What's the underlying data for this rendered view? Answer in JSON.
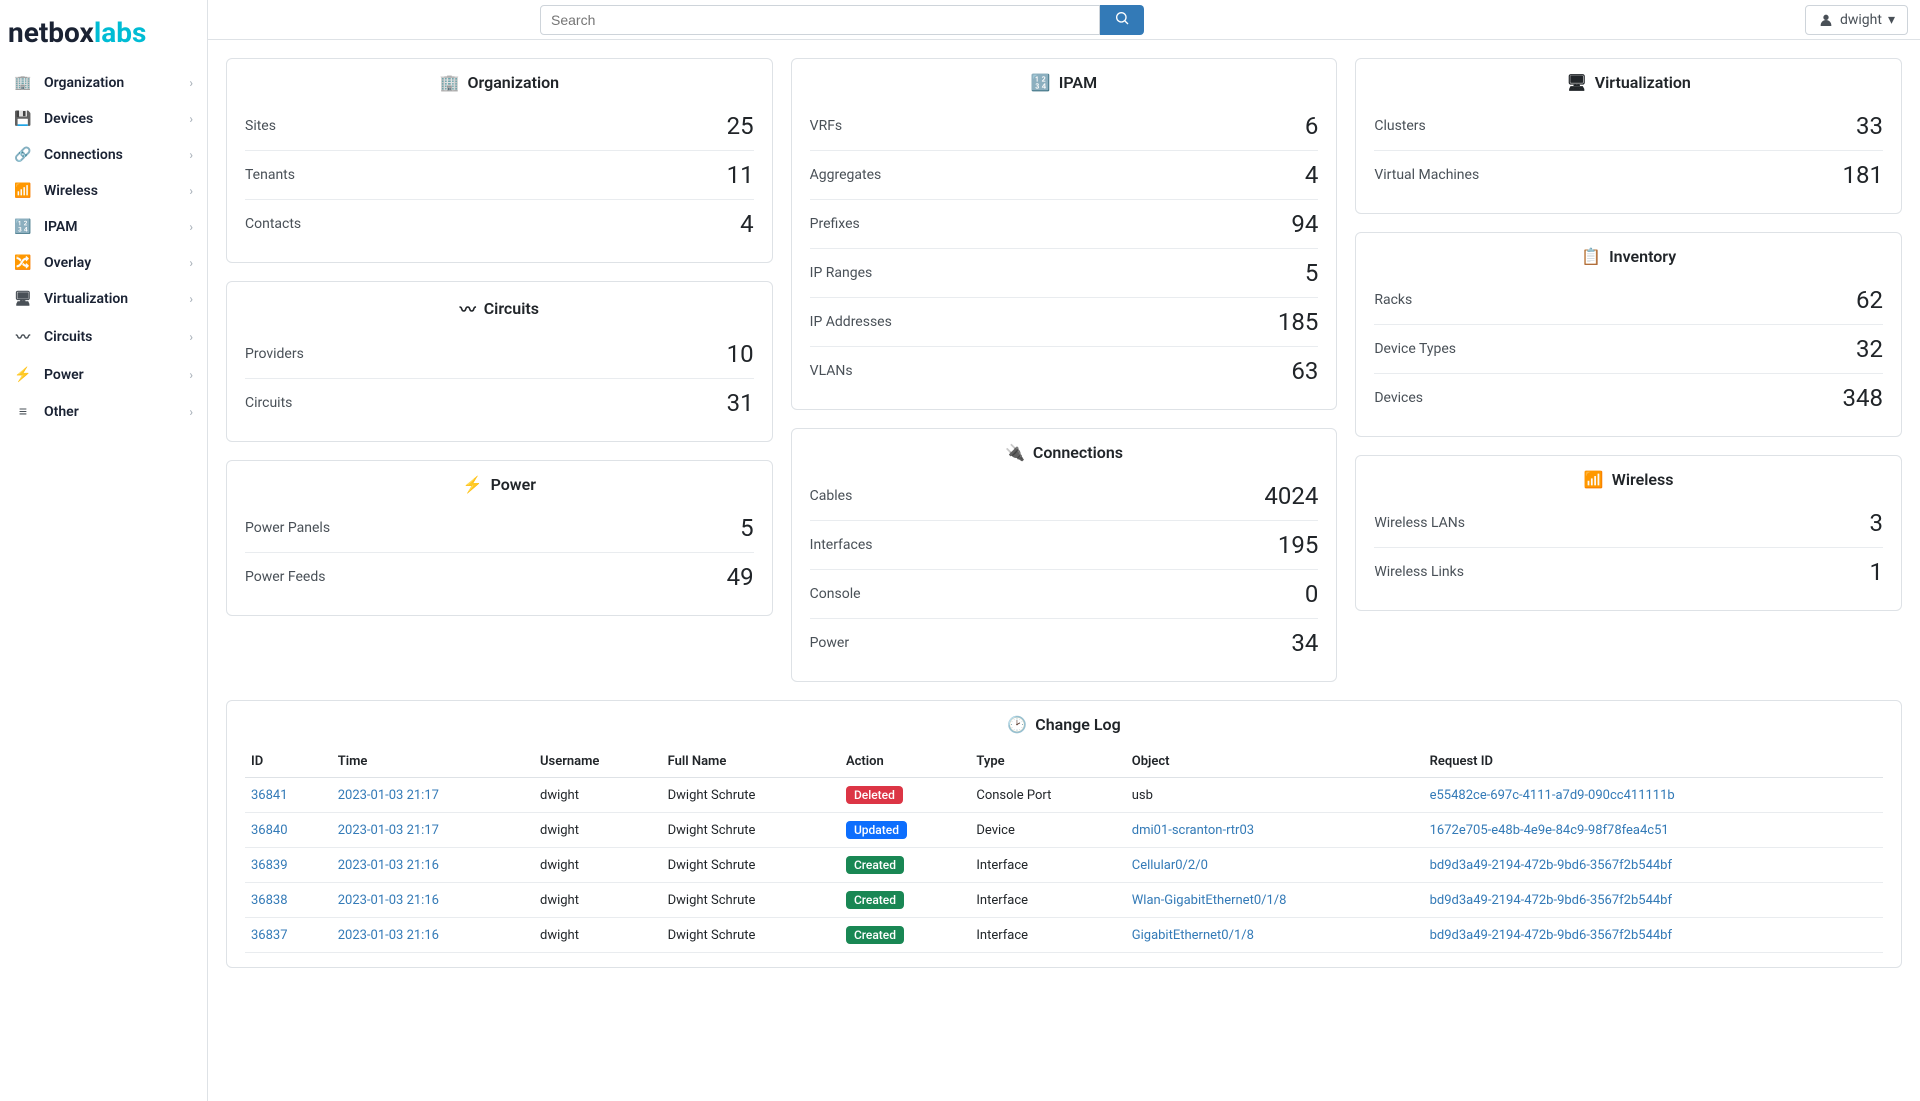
{
  "brand": {
    "part1": "netbox",
    "part2": "labs"
  },
  "search": {
    "placeholder": "Search"
  },
  "user": {
    "name": "dwight"
  },
  "nav": [
    {
      "label": "Organization"
    },
    {
      "label": "Devices"
    },
    {
      "label": "Connections"
    },
    {
      "label": "Wireless"
    },
    {
      "label": "IPAM"
    },
    {
      "label": "Overlay"
    },
    {
      "label": "Virtualization"
    },
    {
      "label": "Circuits"
    },
    {
      "label": "Power"
    },
    {
      "label": "Other"
    }
  ],
  "cards": {
    "organization": {
      "title": "Organization",
      "rows": [
        {
          "label": "Sites",
          "value": "25"
        },
        {
          "label": "Tenants",
          "value": "11"
        },
        {
          "label": "Contacts",
          "value": "4"
        }
      ]
    },
    "circuits": {
      "title": "Circuits",
      "rows": [
        {
          "label": "Providers",
          "value": "10"
        },
        {
          "label": "Circuits",
          "value": "31"
        }
      ]
    },
    "power": {
      "title": "Power",
      "rows": [
        {
          "label": "Power Panels",
          "value": "5"
        },
        {
          "label": "Power Feeds",
          "value": "49"
        }
      ]
    },
    "ipam": {
      "title": "IPAM",
      "rows": [
        {
          "label": "VRFs",
          "value": "6"
        },
        {
          "label": "Aggregates",
          "value": "4"
        },
        {
          "label": "Prefixes",
          "value": "94"
        },
        {
          "label": "IP Ranges",
          "value": "5"
        },
        {
          "label": "IP Addresses",
          "value": "185"
        },
        {
          "label": "VLANs",
          "value": "63"
        }
      ]
    },
    "connections": {
      "title": "Connections",
      "rows": [
        {
          "label": "Cables",
          "value": "4024"
        },
        {
          "label": "Interfaces",
          "value": "195"
        },
        {
          "label": "Console",
          "value": "0"
        },
        {
          "label": "Power",
          "value": "34"
        }
      ]
    },
    "virtualization": {
      "title": "Virtualization",
      "rows": [
        {
          "label": "Clusters",
          "value": "33"
        },
        {
          "label": "Virtual Machines",
          "value": "181"
        }
      ]
    },
    "inventory": {
      "title": "Inventory",
      "rows": [
        {
          "label": "Racks",
          "value": "62"
        },
        {
          "label": "Device Types",
          "value": "32"
        },
        {
          "label": "Devices",
          "value": "348"
        }
      ]
    },
    "wireless": {
      "title": "Wireless",
      "rows": [
        {
          "label": "Wireless LANs",
          "value": "3"
        },
        {
          "label": "Wireless Links",
          "value": "1"
        }
      ]
    }
  },
  "changelog": {
    "title": "Change Log",
    "headers": [
      "ID",
      "Time",
      "Username",
      "Full Name",
      "Action",
      "Type",
      "Object",
      "Request ID"
    ],
    "rows": [
      {
        "id": "36841",
        "time": "2023-01-03 21:17",
        "username": "dwight",
        "fullname": "Dwight Schrute",
        "action": "Deleted",
        "action_class": "badge-deleted",
        "type": "Console Port",
        "object": "usb",
        "object_link": false,
        "request_id": "e55482ce-697c-4111-a7d9-090cc411111b"
      },
      {
        "id": "36840",
        "time": "2023-01-03 21:17",
        "username": "dwight",
        "fullname": "Dwight Schrute",
        "action": "Updated",
        "action_class": "badge-updated",
        "type": "Device",
        "object": "dmi01-scranton-rtr03",
        "object_link": true,
        "request_id": "1672e705-e48b-4e9e-84c9-98f78fea4c51"
      },
      {
        "id": "36839",
        "time": "2023-01-03 21:16",
        "username": "dwight",
        "fullname": "Dwight Schrute",
        "action": "Created",
        "action_class": "badge-created",
        "type": "Interface",
        "object": "Cellular0/2/0",
        "object_link": true,
        "request_id": "bd9d3a49-2194-472b-9bd6-3567f2b544bf"
      },
      {
        "id": "36838",
        "time": "2023-01-03 21:16",
        "username": "dwight",
        "fullname": "Dwight Schrute",
        "action": "Created",
        "action_class": "badge-created",
        "type": "Interface",
        "object": "Wlan-GigabitEthernet0/1/8",
        "object_link": true,
        "request_id": "bd9d3a49-2194-472b-9bd6-3567f2b544bf"
      },
      {
        "id": "36837",
        "time": "2023-01-03 21:16",
        "username": "dwight",
        "fullname": "Dwight Schrute",
        "action": "Created",
        "action_class": "badge-created",
        "type": "Interface",
        "object": "GigabitEthernet0/1/8",
        "object_link": true,
        "request_id": "bd9d3a49-2194-472b-9bd6-3567f2b544bf"
      }
    ]
  }
}
